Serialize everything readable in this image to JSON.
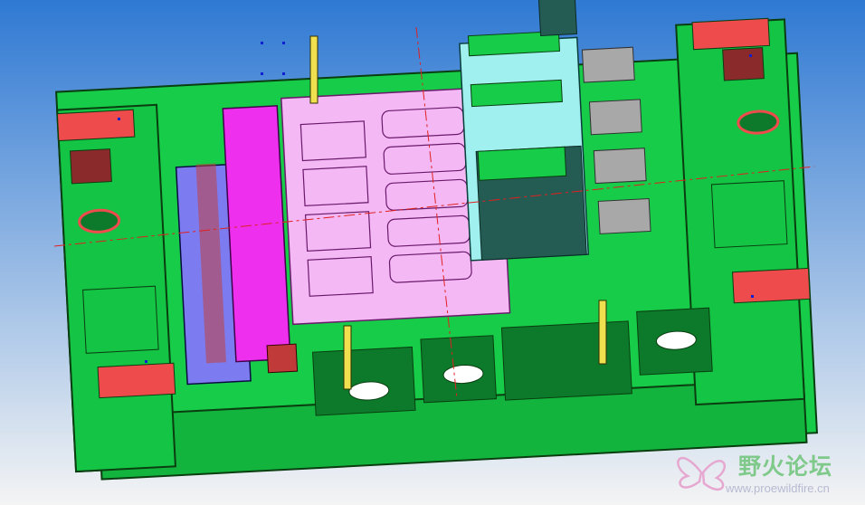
{
  "viewport": {
    "background_top": "#2f79d3",
    "background_bottom": "#f4f4f4"
  },
  "model": {
    "colors": {
      "plate_green": "#16cc48",
      "plate_dark": "#0c7a2a",
      "edge": "#0a3d10",
      "red_block": "#ee4c4c",
      "cavity_pink": "#f4b8f4",
      "slider_magenta": "#ee30ee",
      "lifter_blue": "#7c7cf0",
      "cyan_insert": "#9ff0ee",
      "dark_teal": "#245c54",
      "yellow_pin": "#f0e050",
      "axis_red": "#e02020",
      "axis_blue": "#1020d0"
    }
  },
  "watermark": {
    "title": "野火论坛",
    "url": "www.proewildfire.cn",
    "colors": {
      "title": "#7fc98a",
      "url": "#b9b9d2",
      "logo": "#e6a8d0"
    }
  }
}
